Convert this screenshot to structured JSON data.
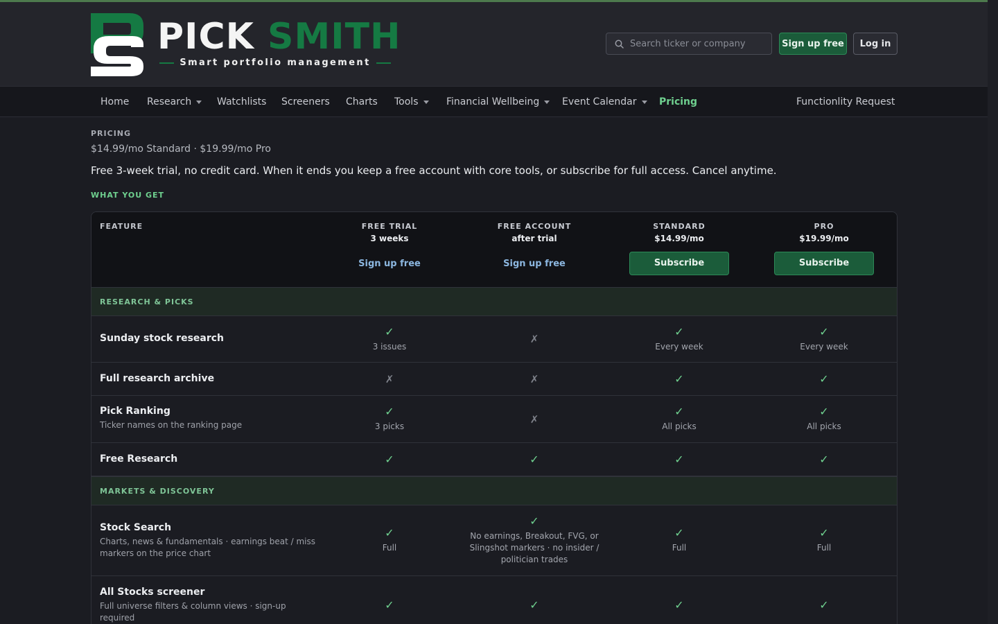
{
  "brand": {
    "name_part1": "PICK",
    "name_part2": "SMITH",
    "tagline": "Smart portfolio management"
  },
  "header": {
    "search_placeholder": "Search ticker or company",
    "signup_label": "Sign up free",
    "login_label": "Log in"
  },
  "nav": {
    "items": [
      {
        "label": "Home"
      },
      {
        "label": "Research"
      },
      {
        "label": "Watchlists"
      },
      {
        "label": "Screeners"
      },
      {
        "label": "Charts"
      },
      {
        "label": "Tools"
      },
      {
        "label": "Financial Wellbeing"
      },
      {
        "label": "Event Calendar"
      },
      {
        "label": "Pricing"
      },
      {
        "label": "Functionlity Request"
      }
    ]
  },
  "page": {
    "eyebrow": "PRICING",
    "prices": "$14.99/mo Standard · $19.99/mo Pro",
    "intro": "Free 3-week trial, no credit card. When it ends you keep a free account with core tools, or subscribe for full access. Cancel anytime.",
    "section_label": "WHAT YOU GET"
  },
  "table": {
    "feature_header": "FEATURE",
    "plans": [
      {
        "name": "FREE TRIAL",
        "sub": "3 weeks",
        "action": "Sign up free"
      },
      {
        "name": "FREE ACCOUNT",
        "sub": "after trial",
        "action": "Sign up free"
      },
      {
        "name": "STANDARD",
        "sub": "$14.99/mo",
        "action": "Subscribe"
      },
      {
        "name": "PRO",
        "sub": "$19.99/mo",
        "action": "Subscribe"
      }
    ],
    "check_symbol": "✓",
    "cross_symbol": "✗",
    "sections": [
      {
        "label": "RESEARCH & PICKS"
      },
      {
        "label": "MARKETS & DISCOVERY"
      }
    ],
    "rows": [
      {
        "title": "Sunday stock research",
        "desc": "",
        "cells": [
          {
            "note": "3 issues"
          },
          {
            "note": ""
          },
          {
            "note": "Every week"
          },
          {
            "note": "Every week"
          }
        ]
      },
      {
        "title": "Full research archive",
        "desc": ""
      },
      {
        "title": "Pick Ranking",
        "desc": "Ticker names on the ranking page",
        "cells": [
          {
            "note": "3 picks"
          },
          {
            "note": ""
          },
          {
            "note": "All picks"
          },
          {
            "note": "All picks"
          }
        ]
      },
      {
        "title": "Free Research",
        "desc": ""
      },
      {
        "title": "Stock Search",
        "desc": "Charts, news & fundamentals · earnings beat / miss markers on the price chart",
        "cells": [
          {
            "note": "Full"
          },
          {
            "note": "No earnings, Breakout, FVG, or Slingshot markers · no insider / politician trades"
          },
          {
            "note": "Full"
          },
          {
            "note": "Full"
          }
        ]
      },
      {
        "title": "All Stocks screener",
        "desc": "Full universe filters & column views · sign-up required"
      }
    ]
  },
  "colors": {
    "accent_green": "#6fd08f",
    "brand_green": "#157a43",
    "button_green": "#1b5c3a",
    "link_blue": "#8cb7e0",
    "background": "#1b1c22"
  }
}
